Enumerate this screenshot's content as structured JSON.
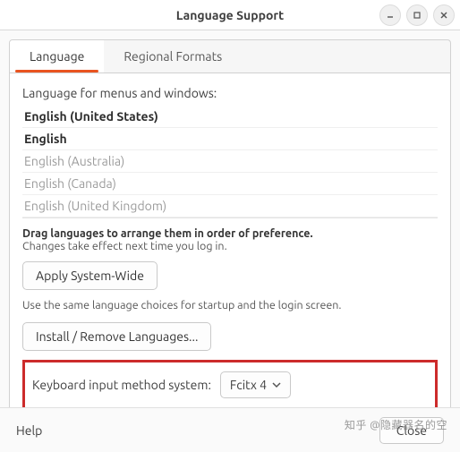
{
  "window": {
    "title": "Language Support"
  },
  "tabs": {
    "language": "Language",
    "regional": "Regional Formats"
  },
  "panel": {
    "menu_label": "Language for menus and windows:",
    "languages": [
      {
        "name": "English (United States)",
        "installed": true
      },
      {
        "name": "English",
        "installed": true
      },
      {
        "name": "English (Australia)",
        "installed": false
      },
      {
        "name": "English (Canada)",
        "installed": false
      },
      {
        "name": "English (United Kingdom)",
        "installed": false
      }
    ],
    "drag_hint": "Drag languages to arrange them in order of preference.",
    "effect_hint": "Changes take effect next time you log in.",
    "apply_btn": "Apply System-Wide",
    "apply_note": "Use the same language choices for startup and the login screen.",
    "install_btn": "Install / Remove Languages...",
    "input_label": "Keyboard input method system:",
    "input_value": "Fcitx 4"
  },
  "footer": {
    "help": "Help",
    "close": "Close"
  },
  "watermark": "知乎 @隐藏器名的空"
}
